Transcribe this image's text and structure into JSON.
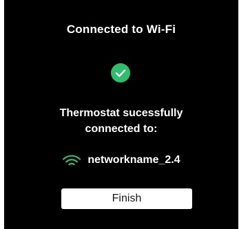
{
  "screen": {
    "title": "Connected to Wi-Fi",
    "status_icon": "check-circle-icon",
    "message": "Thermostat sucessfully connected to:",
    "network": {
      "icon": "wifi-icon",
      "name": "networkname_2.4"
    },
    "finish_label": "Finish"
  },
  "colors": {
    "background": "#000000",
    "text": "#ffffff",
    "accent_green": "#2fbe6b",
    "button_background": "#ffffff",
    "button_text": "#1a1a1a"
  }
}
